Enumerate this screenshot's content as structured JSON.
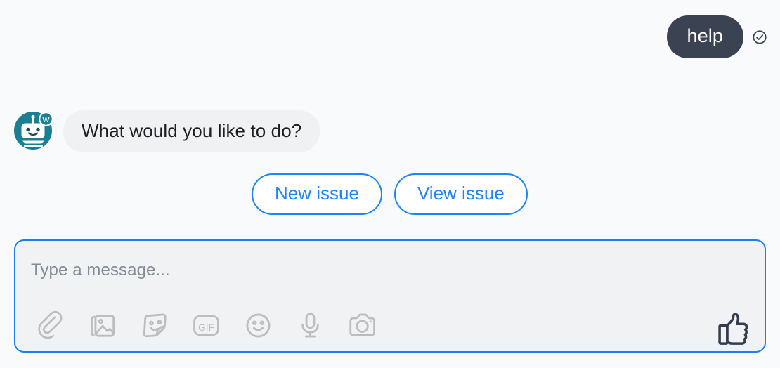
{
  "theme": {
    "page_background": "#f8fafc",
    "user_bubble_color": "#3b4352",
    "bot_bubble_color": "#f0f1f3",
    "accent_blue": "#1a85fc",
    "composer_border": "#1a7ff0",
    "avatar_teal": "#1b7f94",
    "icon_gray": "#bdbdbd",
    "thumb_color": "#343d4d"
  },
  "conversation": {
    "user_message": {
      "text": "help",
      "status_icon": "check-circle-icon"
    },
    "bot_message": {
      "text": "What would you like to do?",
      "avatar_icon": "robot-avatar-icon",
      "avatar_badge_letter": "W"
    },
    "quick_replies": [
      {
        "label": "New issue"
      },
      {
        "label": "View issue"
      }
    ]
  },
  "composer": {
    "placeholder": "Type a message...",
    "value": "",
    "actions": [
      {
        "icon": "paperclip-icon",
        "label": "Attach file"
      },
      {
        "icon": "photo-icon",
        "label": "Send photo"
      },
      {
        "icon": "sticker-icon",
        "label": "Send sticker"
      },
      {
        "icon": "gif-icon",
        "label": "GIF"
      },
      {
        "icon": "emoji-icon",
        "label": "Emoji"
      },
      {
        "icon": "microphone-icon",
        "label": "Voice message"
      },
      {
        "icon": "camera-icon",
        "label": "Camera"
      }
    ],
    "send_action": {
      "icon": "thumbs-up-icon",
      "label": "Like"
    }
  }
}
